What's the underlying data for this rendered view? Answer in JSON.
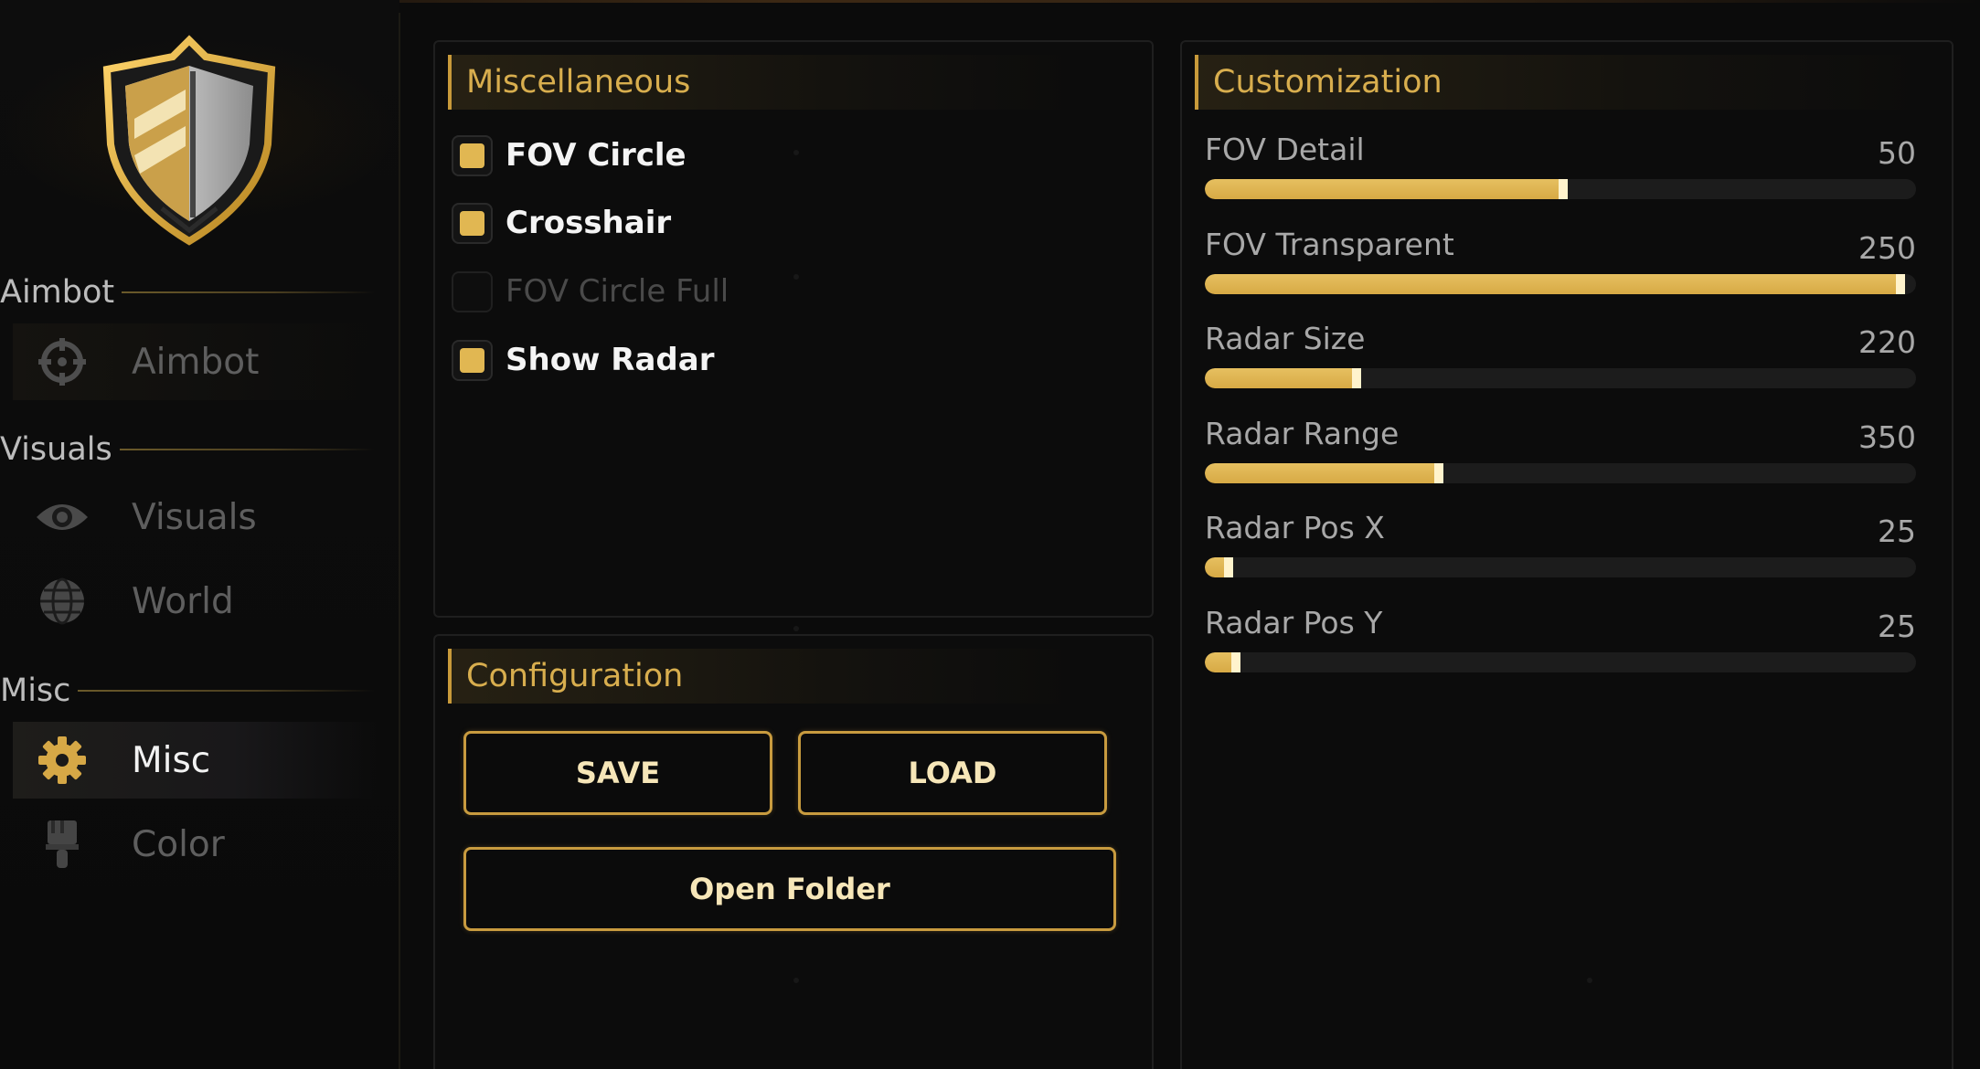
{
  "sidebar": {
    "sections": [
      {
        "header": "Aimbot",
        "items": [
          {
            "label": "Aimbot",
            "icon": "crosshair-icon",
            "active": false
          }
        ]
      },
      {
        "header": "Visuals",
        "items": [
          {
            "label": "Visuals",
            "icon": "eye-icon",
            "active": false
          },
          {
            "label": "World",
            "icon": "globe-icon",
            "active": false
          }
        ]
      },
      {
        "header": "Misc",
        "items": [
          {
            "label": "Misc",
            "icon": "gear-icon",
            "active": true
          },
          {
            "label": "Color",
            "icon": "brush-icon",
            "active": false
          }
        ]
      }
    ]
  },
  "misc_panel": {
    "title": "Miscellaneous",
    "checkboxes": [
      {
        "label": "FOV Circle",
        "checked": true
      },
      {
        "label": "Crosshair",
        "checked": true
      },
      {
        "label": "FOV Circle Full",
        "checked": false
      },
      {
        "label": "Show Radar",
        "checked": true
      }
    ]
  },
  "config_panel": {
    "title": "Configuration",
    "save_label": "SAVE",
    "load_label": "LOAD",
    "open_folder_label": "Open Folder"
  },
  "custom_panel": {
    "title": "Customization",
    "sliders": [
      {
        "label": "FOV Detail",
        "value": "50",
        "fill": 0.51
      },
      {
        "label": "FOV Transparent",
        "value": "250",
        "fill": 0.985
      },
      {
        "label": "Radar Size",
        "value": "220",
        "fill": 0.22
      },
      {
        "label": "Radar Range",
        "value": "350",
        "fill": 0.335
      },
      {
        "label": "Radar Pos X",
        "value": "25",
        "fill": 0.04
      },
      {
        "label": "Radar Pos Y",
        "value": "25",
        "fill": 0.05
      }
    ]
  },
  "colors": {
    "accent": "#d8ae4e",
    "checkbox_fill": "#e1b752",
    "button_border": "#c89b3f",
    "background": "#0b0b0b"
  }
}
